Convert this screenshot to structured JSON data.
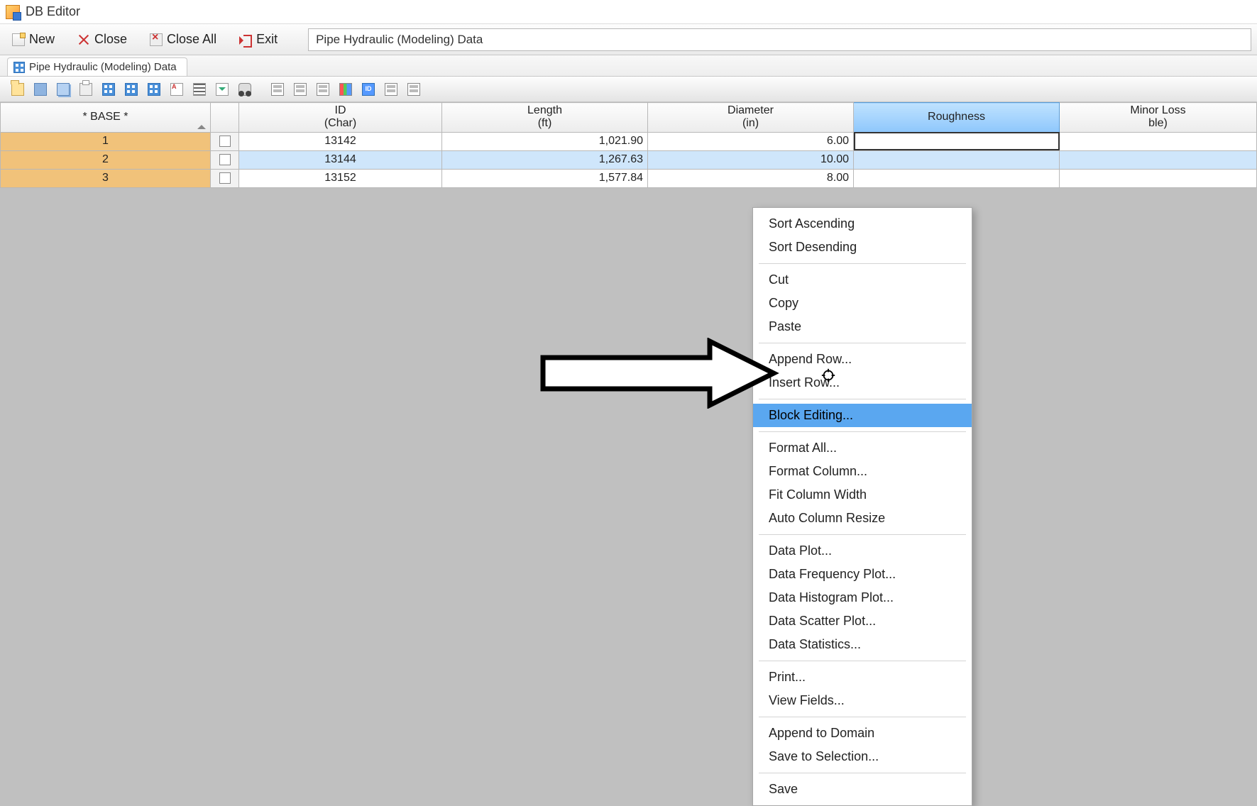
{
  "app": {
    "title": "DB Editor"
  },
  "toolbar": {
    "new_label": "New",
    "close_label": "Close",
    "close_all_label": "Close All",
    "exit_label": "Exit"
  },
  "dataset_selector": {
    "value": "Pipe Hydraulic (Modeling) Data"
  },
  "tab": {
    "label": "Pipe Hydraulic (Modeling) Data"
  },
  "grid": {
    "base_header": "* BASE *",
    "columns": [
      {
        "label_line1": "ID",
        "label_line2": "(Char)"
      },
      {
        "label_line1": "Length",
        "label_line2": "(ft)"
      },
      {
        "label_line1": "Diameter",
        "label_line2": "(in)"
      },
      {
        "label_line1": "Roughness",
        "label_line2": ""
      },
      {
        "label_line1": "Minor Loss",
        "label_line2": "ble)"
      }
    ],
    "rows": [
      {
        "n": "1",
        "id": "13142",
        "length": "1,021.90",
        "diameter": "6.00",
        "roughness": "",
        "minor_loss": ""
      },
      {
        "n": "2",
        "id": "13144",
        "length": "1,267.63",
        "diameter": "10.00",
        "roughness": "",
        "minor_loss": ""
      },
      {
        "n": "3",
        "id": "13152",
        "length": "1,577.84",
        "diameter": "8.00",
        "roughness": "",
        "minor_loss": ""
      }
    ],
    "selected_column_index": 3,
    "editing_cell": {
      "row": 0,
      "col": "roughness"
    }
  },
  "context_menu": {
    "highlighted_index": 7,
    "items": [
      "Sort Ascending",
      "Sort Desending",
      "-",
      "Cut",
      "Copy",
      "Paste",
      "-",
      "Append Row...",
      "Insert Row...",
      "-",
      "Block Editing...",
      "-",
      "Format All...",
      "Format Column...",
      "Fit Column Width",
      "Auto Column Resize",
      "-",
      "Data Plot...",
      "Data Frequency Plot...",
      "Data Histogram Plot...",
      "Data Scatter Plot...",
      "Data Statistics...",
      "-",
      "Print...",
      "View Fields...",
      "-",
      "Append to Domain",
      "Save to Selection...",
      "-",
      "Save"
    ]
  },
  "context_menu_labels": {
    "sort_asc": "Sort Ascending",
    "sort_desc": "Sort Desending",
    "cut": "Cut",
    "copy": "Copy",
    "paste": "Paste",
    "append_row": "Append Row...",
    "insert_row": "Insert Row...",
    "block_editing": "Block Editing...",
    "format_all": "Format All...",
    "format_column": "Format Column...",
    "fit_col_width": "Fit Column Width",
    "auto_col_resize": "Auto Column Resize",
    "data_plot": "Data Plot...",
    "data_freq_plot": "Data Frequency Plot...",
    "data_hist_plot": "Data Histogram Plot...",
    "data_scatter_plot": "Data Scatter Plot...",
    "data_stats": "Data Statistics...",
    "print": "Print...",
    "view_fields": "View Fields...",
    "append_domain": "Append to Domain",
    "save_sel": "Save to Selection...",
    "save": "Save"
  }
}
